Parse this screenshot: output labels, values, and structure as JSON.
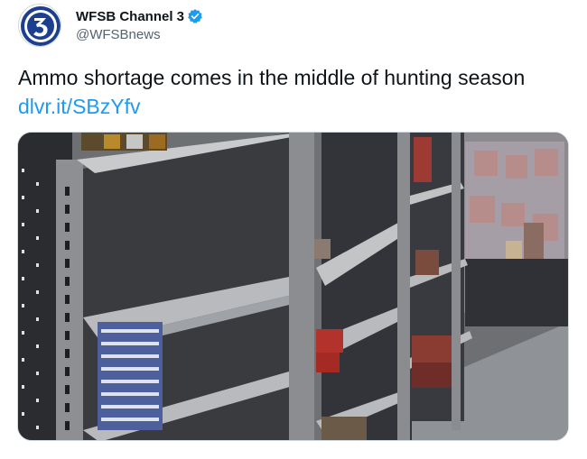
{
  "tweet": {
    "author": {
      "display_name": "WFSB Channel 3",
      "handle": "@WFSBnews",
      "verified": true,
      "avatar_icon": "channel-3-logo-icon",
      "brand_color": "#1c3f8f"
    },
    "text": "Ammo shortage comes in the middle of hunting season",
    "link": "dlvr.it/SBzYfv",
    "link_color": "#1d9bf0",
    "media": {
      "description_icon": "store-shelves-photo"
    }
  }
}
